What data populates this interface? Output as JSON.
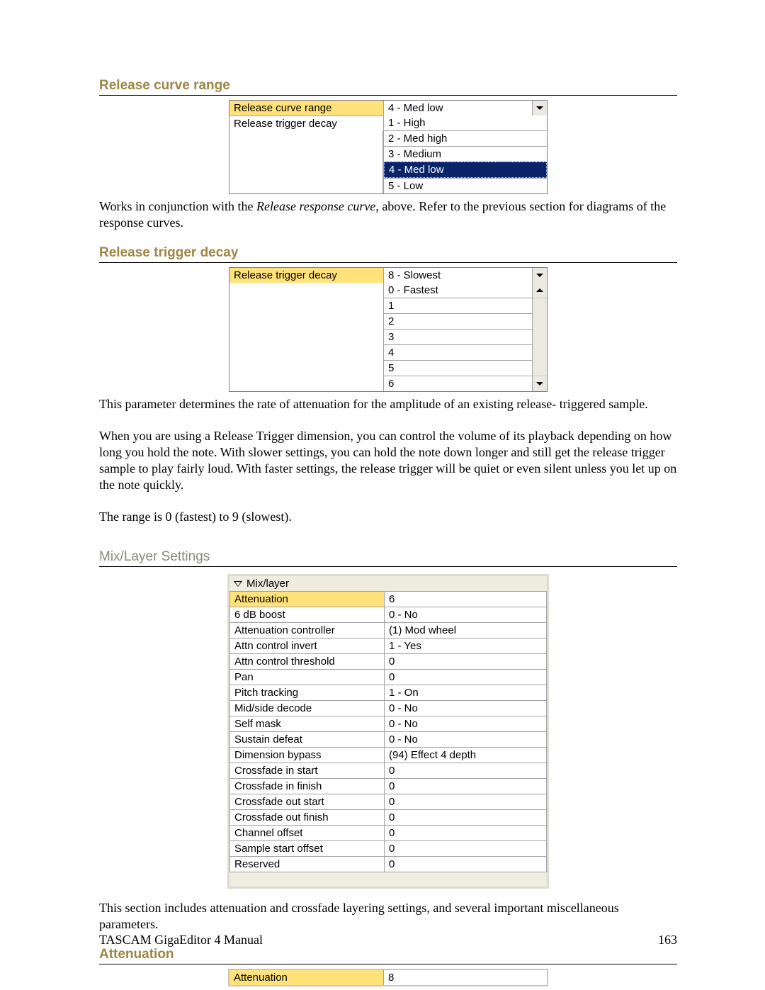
{
  "headings": {
    "release_curve_range": "Release curve range",
    "release_trigger_decay": "Release trigger decay",
    "mix_layer_settings": "Mix/Layer Settings",
    "attenuation": "Attenuation"
  },
  "rcr_panel": {
    "row1_label": "Release curve range",
    "row1_value": "4 - Med low",
    "row2_label": "Release trigger decay",
    "options": {
      "o1": "1 - High",
      "o2": "2 - Med high",
      "o3": "3 - Medium",
      "o4": "4 - Med low",
      "o5": "5 - Low"
    }
  },
  "rcr_text_before": "Works in conjunction with the ",
  "rcr_text_em": "Release response curve",
  "rcr_text_after": ", above.  Refer to the previous section for diagrams of the response curves.",
  "rtd_panel": {
    "row1_label": "Release trigger decay",
    "row1_value": "8 - Slowest",
    "options": {
      "o0": "0 - Fastest",
      "o1": "1",
      "o2": "2",
      "o3": "3",
      "o4": "4",
      "o5": "5",
      "o6": "6"
    }
  },
  "rtd_text_p1": "This parameter determines the rate of attenuation for the amplitude of an existing release- triggered sample.",
  "rtd_text_p2": "When you are using a Release Trigger dimension, you can control the volume of its playback depending on how long you hold the note.  With slower settings, you can hold the note down longer and still get the release trigger sample to play fairly loud.  With faster settings, the release trigger will be quiet or even silent unless you let up on the note quickly.",
  "rtd_text_p3": "The range is 0 (fastest) to 9 (slowest).",
  "mix_panel": {
    "section_title": "Mix/layer",
    "rows": {
      "r0_l": "Attenuation",
      "r0_v": "6",
      "r1_l": "6 dB boost",
      "r1_v": "0 - No",
      "r2_l": "Attenuation controller",
      "r2_v": "(1) Mod wheel",
      "r3_l": "Attn control invert",
      "r3_v": "1 - Yes",
      "r4_l": "Attn control threshold",
      "r4_v": "0",
      "r5_l": "Pan",
      "r5_v": "0",
      "r6_l": "Pitch tracking",
      "r6_v": "1 - On",
      "r7_l": "Mid/side decode",
      "r7_v": "0 - No",
      "r8_l": "Self mask",
      "r8_v": "0 - No",
      "r9_l": "Sustain defeat",
      "r9_v": "0 - No",
      "r10_l": "Dimension bypass",
      "r10_v": "(94) Effect 4 depth",
      "r11_l": "Crossfade in start",
      "r11_v": "0",
      "r12_l": "Crossfade in finish",
      "r12_v": "0",
      "r13_l": "Crossfade out start",
      "r13_v": "0",
      "r14_l": "Crossfade out finish",
      "r14_v": "0",
      "r15_l": "Channel offset",
      "r15_v": "0",
      "r16_l": "Sample start offset",
      "r16_v": "0",
      "r17_l": "Reserved",
      "r17_v": "0"
    }
  },
  "mix_text": "This section includes attenuation and crossfade layering settings, and several important miscellaneous parameters.",
  "atten_panel": {
    "label": "Attenuation",
    "value": "8"
  },
  "footer": {
    "left": "TASCAM GigaEditor 4 Manual",
    "right": "163"
  }
}
